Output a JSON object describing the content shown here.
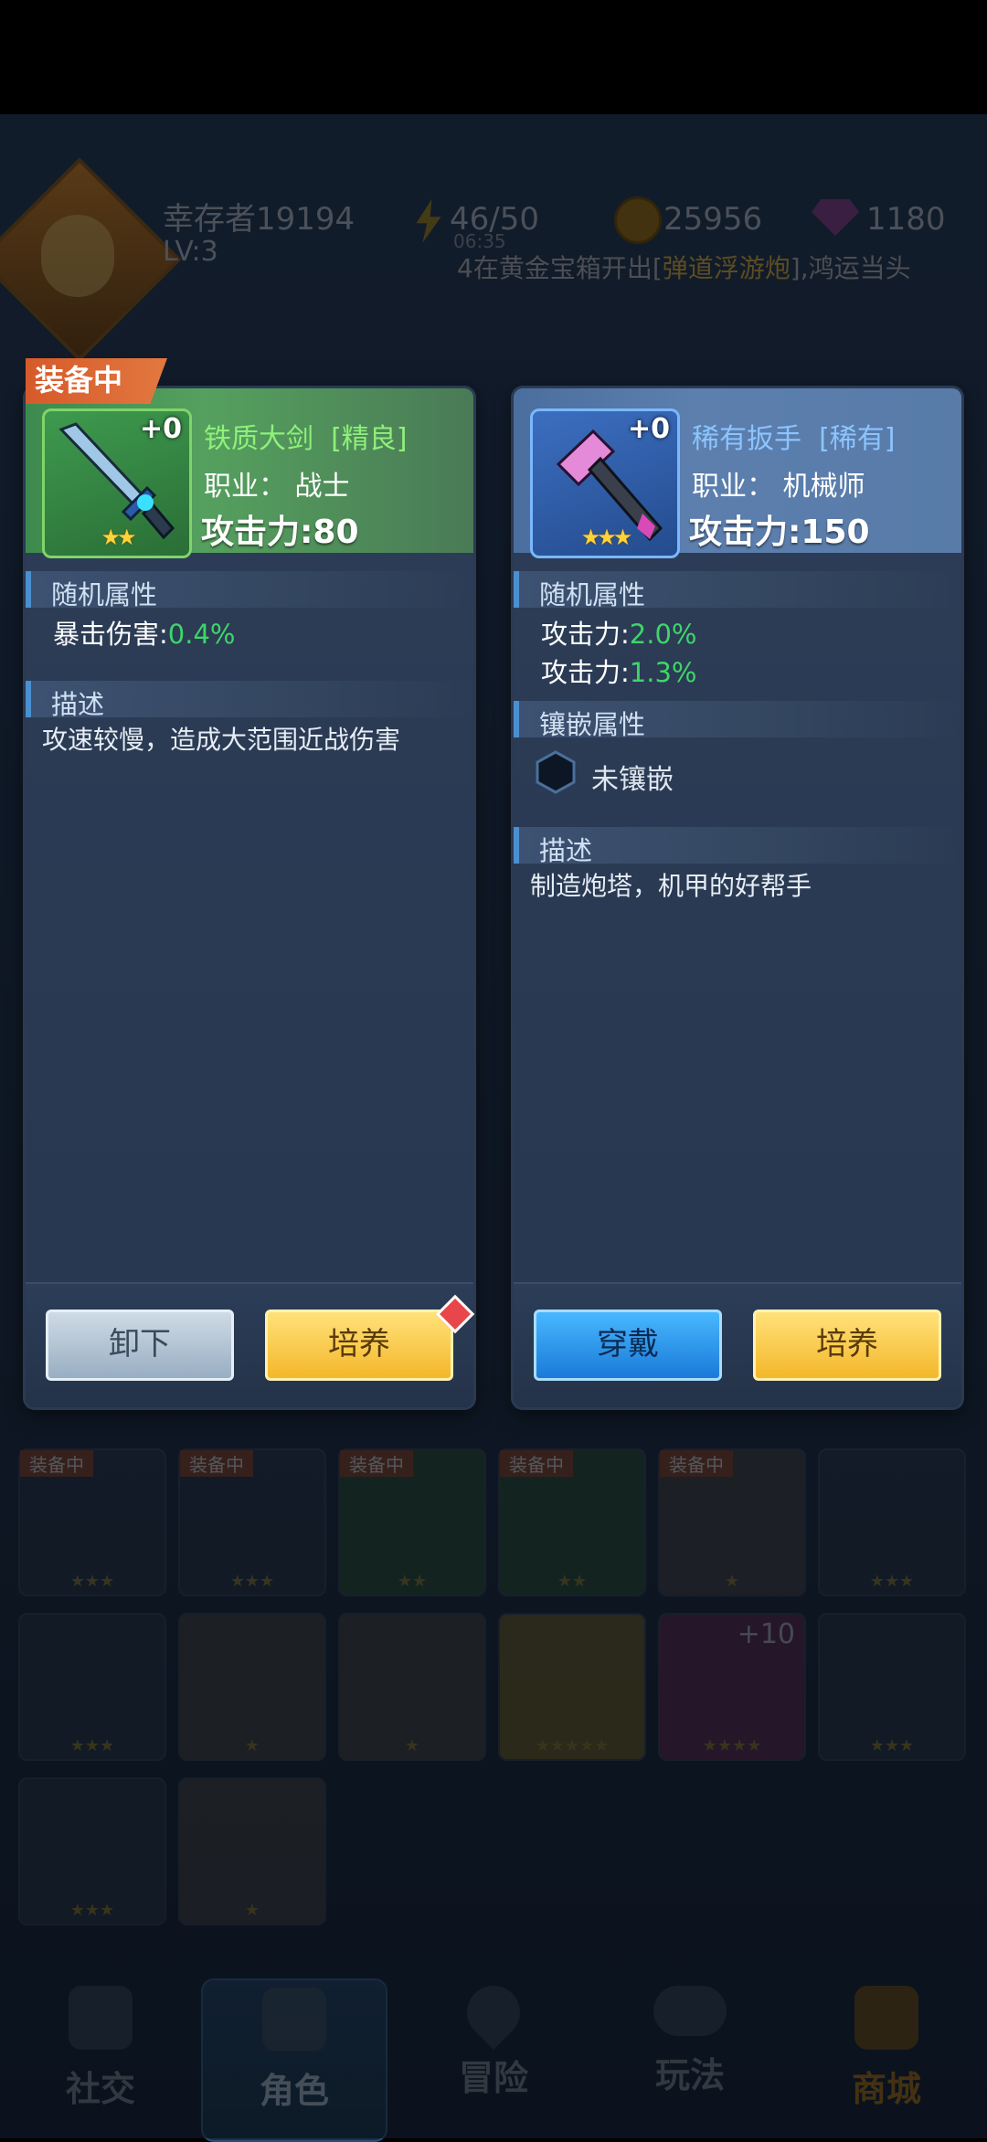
{
  "hud": {
    "player_name": "幸存者19194",
    "level": "LV:3",
    "energy": "46/50",
    "energy_timer": "06:35",
    "coins": "25956",
    "gems": "1180",
    "ticker_prefix": "4在黄金宝箱开出[",
    "ticker_item": "弹道浮游炮",
    "ticker_suffix": "],鸿运当头"
  },
  "left_panel": {
    "badge": "装备中",
    "plus": "+0",
    "stars": "★★",
    "name": "铁质大剑",
    "rarity": "[精良]",
    "job": "职业：  战士",
    "attack": "攻击力:80",
    "random_attr_title": "随机属性",
    "attrs": [
      {
        "label": "暴击伤害:",
        "value": "0.4%"
      }
    ],
    "desc_title": "描述",
    "desc": "攻速较慢，造成大范围近战伤害",
    "btn_unequip": "卸下",
    "btn_train": "培养"
  },
  "right_panel": {
    "plus": "+0",
    "stars": "★★★",
    "name": "稀有扳手",
    "rarity": "[稀有]",
    "job": "职业：  机械师",
    "attack": "攻击力:150",
    "random_attr_title": "随机属性",
    "attrs": [
      {
        "label": "攻击力:",
        "value": "2.0%"
      },
      {
        "label": "攻击力:",
        "value": "1.3%"
      }
    ],
    "socket_title": "镶嵌属性",
    "socket_text": "未镶嵌",
    "desc_title": "描述",
    "desc": "制造炮塔，机甲的好帮手",
    "btn_wear": "穿戴",
    "btn_train": "培养"
  },
  "inventory": {
    "equipped_tag": "装备中",
    "plus_ten": "+10"
  },
  "nav": {
    "social": "社交",
    "character": "角色",
    "adventure": "冒险",
    "gameplay": "玩法",
    "shop": "商城"
  },
  "colors": {
    "green_value": "#3fd56a",
    "rarity_green": "#8ff07a",
    "rarity_blue": "#8cc4ff",
    "badge_orange": "#d65a2a"
  }
}
